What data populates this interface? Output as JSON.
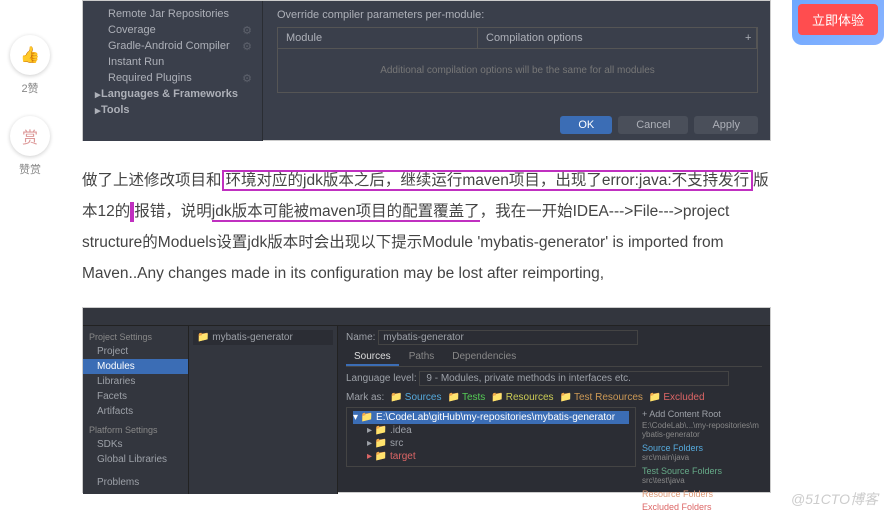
{
  "leftActions": {
    "like_count": "2赞",
    "reward_icon": "赏",
    "reward_label": "赞赏"
  },
  "cta": {
    "label": "立即体验"
  },
  "shot1": {
    "tree": [
      "Remote Jar Repositories",
      "Coverage",
      "Gradle-Android Compiler",
      "Instant Run",
      "Required Plugins"
    ],
    "tree_lang": "Languages & Frameworks",
    "tree_tools": "Tools",
    "override_label": "Override compiler parameters per-module:",
    "module_hdr": "Module",
    "compile_hdr": "Compilation options",
    "plus": "+",
    "empty_msg": "Additional compilation options will be the same for all modules",
    "ok": "OK",
    "cancel": "Cancel",
    "apply": "Apply"
  },
  "para": {
    "t1": "做了上述修改项目和",
    "t2": "环境对应的jdk版本之后，继续运行maven项目，出现了error:java:不支持发行",
    "t3": "版本12的",
    "t4": "报错，说明",
    "t5": "jdk版本可能被maven项目的配置覆盖了",
    "t6": "，我在一开始IDEA--->File--->project structure的Moduels设置jdk版本时会出现以下提示Module 'mybatis-generator' is imported from Maven..Any changes made in its configuration may be lost after reimporting,"
  },
  "shot2": {
    "ps_hdr": "Project Settings",
    "ps_items": [
      "Project",
      "Modules",
      "Libraries",
      "Facets",
      "Artifacts"
    ],
    "pf_hdr": "Platform Settings",
    "pf_items": [
      "SDKs",
      "Global Libraries"
    ],
    "problems": "Problems",
    "module_name": "mybatis-generator",
    "name_label": "Name:",
    "name_value": "mybatis-generator",
    "tabs": [
      "Sources",
      "Paths",
      "Dependencies"
    ],
    "lang_label": "Language level:",
    "lang_value": "9 - Modules, private methods in interfaces etc.",
    "mark_label": "Mark as:",
    "marks": [
      "Sources",
      "Tests",
      "Resources",
      "Test Resources",
      "Excluded"
    ],
    "root_path": "E:\\CodeLab\\gitHub\\my-repositories\\mybatis-generator",
    "folders": [
      ".idea",
      "src",
      "target"
    ],
    "add_content": "+ Add Content Root",
    "content_path": "E:\\CodeLab\\...\\my-repositories\\mybatis-generator",
    "source_folders": "Source Folders",
    "src_main": "src\\main\\java",
    "test_source": "Test Source Folders",
    "src_test": "src\\test\\java",
    "resource_folders": "Resource Folders",
    "excluded_folders": "Excluded Folders"
  },
  "watermark": "@51CTO博客"
}
